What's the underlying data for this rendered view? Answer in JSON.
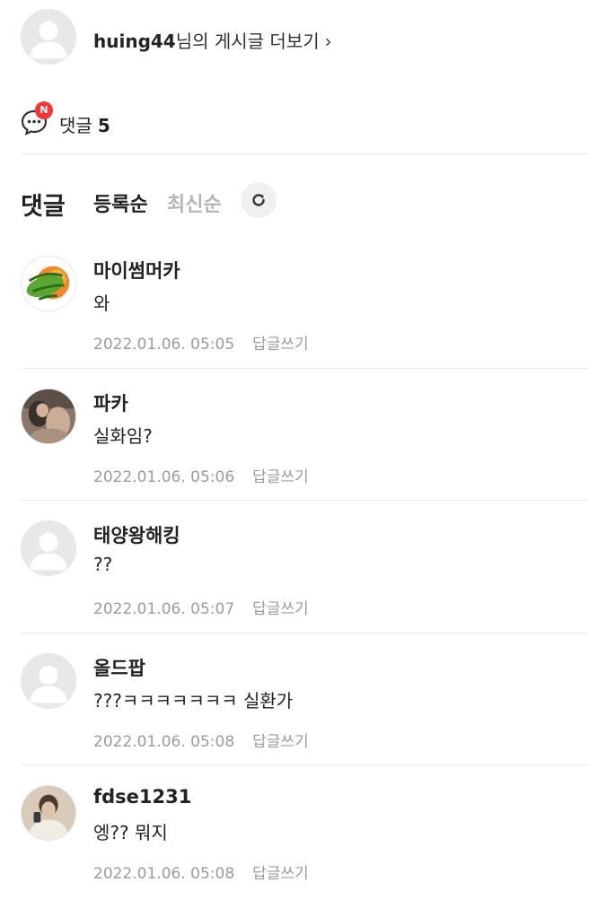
{
  "author": {
    "nickname": "huing44",
    "more_posts_suffix": "님의 게시글 더보기",
    "chevron": "›",
    "avatar_icon": "default-profile-icon"
  },
  "comment_summary": {
    "label": "댓글",
    "count": "5",
    "new_badge": "N",
    "badge_color": "#f53535"
  },
  "comments_header": {
    "title": "댓글",
    "sort_options": [
      {
        "label": "등록순",
        "active": true
      },
      {
        "label": "최신순",
        "active": false
      }
    ],
    "refresh_icon": "refresh-icon"
  },
  "comments": [
    {
      "nickname": "마이썸머카",
      "text": "와",
      "date": "2022.01.06. 05:05",
      "reply_label": "답글쓰기",
      "avatar": "my-summer-car-logo"
    },
    {
      "nickname": "파카",
      "text": "실화임?",
      "date": "2022.01.06. 05:06",
      "reply_label": "답글쓰기",
      "avatar": "photo-avatar"
    },
    {
      "nickname": "태양왕해킹",
      "text": "??",
      "date": "2022.01.06. 05:07",
      "reply_label": "답글쓰기",
      "avatar": "default-profile-icon"
    },
    {
      "nickname": "올드팝",
      "text": "???ㅋㅋㅋㅋㅋㅋㅋ 실환가",
      "date": "2022.01.06. 05:08",
      "reply_label": "답글쓰기",
      "avatar": "default-profile-icon"
    },
    {
      "nickname": "fdse1231",
      "text": "엥?? 뭐지",
      "date": "2022.01.06. 05:08",
      "reply_label": "답글쓰기",
      "avatar": "photo-avatar"
    }
  ]
}
